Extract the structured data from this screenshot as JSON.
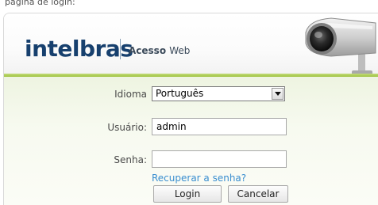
{
  "header": {
    "caption": "página de login:",
    "logo": "intelbras",
    "subtitle_bold": "Acesso",
    "subtitle_light": "Web"
  },
  "form": {
    "language_label": "Idioma",
    "language_value": "Português",
    "user_label": "Usuário:",
    "user_value": "admin",
    "password_label": "Senha:",
    "password_value": "",
    "recover_link": "Recuperar a senha?",
    "login_button": "Login",
    "cancel_button": "Cancelar"
  },
  "colors": {
    "brand": "#17406e",
    "accent_green": "#9fc23e",
    "link": "#3a8ed0"
  },
  "icons": {
    "camera": "security-camera-icon",
    "dropdown": "chevron-down-icon"
  }
}
